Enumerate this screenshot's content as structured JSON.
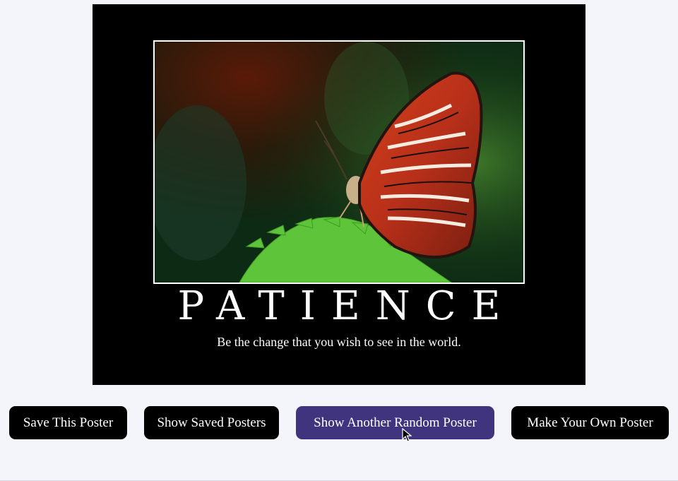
{
  "poster": {
    "title": "PATIENCE",
    "quote": "Be the change that you wish to see in the world."
  },
  "buttons": {
    "save": "Save This Poster",
    "show_saved": "Show Saved Posters",
    "random": "Show Another Random Poster",
    "make_own": "Make Your Own Poster"
  },
  "colors": {
    "page_bg": "#f4f4fb",
    "poster_bg": "#000000",
    "button_bg": "#000000",
    "button_active_bg": "#40347e",
    "text": "#ffffff"
  },
  "icons": {
    "cursor": "mouse-pointer-icon"
  }
}
